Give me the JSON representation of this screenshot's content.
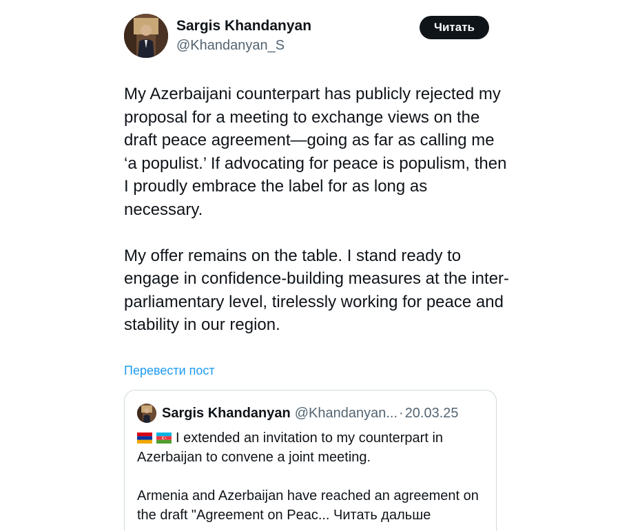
{
  "author": {
    "name": "Sargis Khandanyan",
    "handle": "@Khandanyan_S"
  },
  "header": {
    "read_button_label": "Читать"
  },
  "tweet": {
    "paragraphs": [
      "My Azerbaijani counterpart has publicly rejected my proposal for a meeting to exchange views on the draft peace agreement—going as far as calling me ‘a populist.’ If advocating for peace is populism, then I proudly embrace the label for as long as necessary.",
      "My offer remains on the table. I stand ready to engage in confidence-building measures at the inter-parliamentary level, tirelessly working for peace and stability in our region."
    ],
    "translate_label": "Перевести пост"
  },
  "quoted": {
    "name": "Sargis Khandanyan",
    "handle": "@Khandanyan...",
    "separator": "·",
    "date": "20.03.25",
    "flags": [
      "armenia-flag",
      "azerbaijan-flag"
    ],
    "text_1": "I extended an invitation to my counterpart in Azerbaijan to convene a joint meeting.",
    "text_2": "Armenia and Azerbaijan have reached an agreement on the draft \"Agreement on Peac...",
    "read_more_label": "Читать дальше"
  },
  "colors": {
    "text": "#0f1419",
    "secondary": "#536471",
    "link": "#1d9bf0",
    "border": "#cfd9de"
  }
}
